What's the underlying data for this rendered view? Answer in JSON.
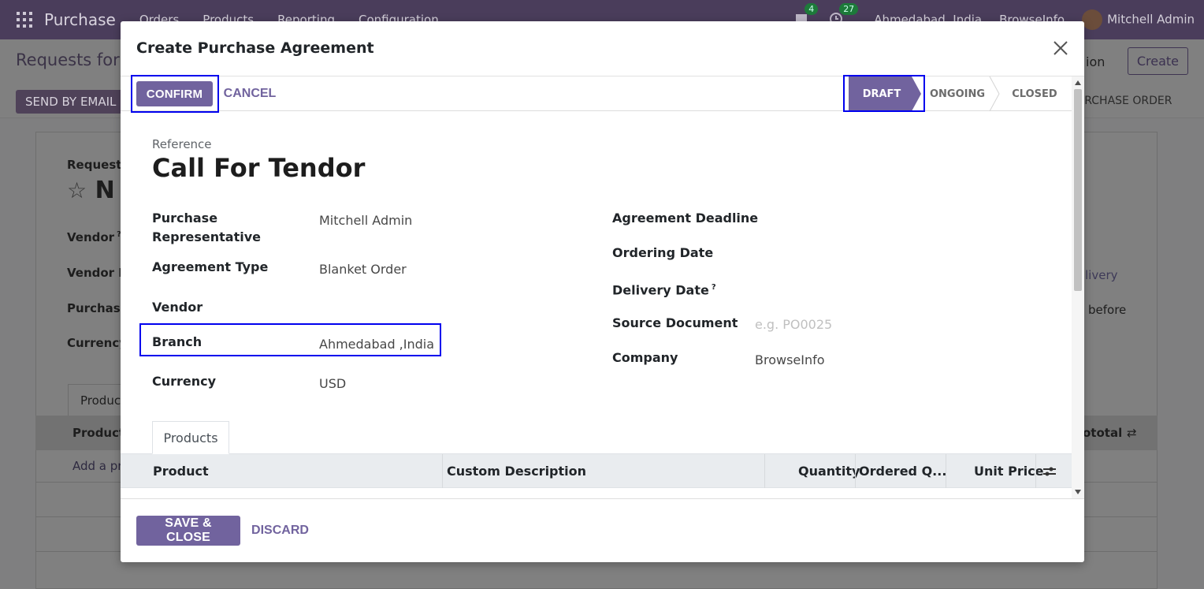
{
  "background": {
    "app_name": "Purchase",
    "menu": [
      "Orders",
      "Products",
      "Reporting",
      "Configuration"
    ],
    "messages_count": "4",
    "activities_count": "27",
    "branch": "Ahmedabad ,India",
    "company": "BrowseInfo",
    "user": "Mitchell Admin",
    "breadcrumb": "Requests for",
    "create_label": "Create",
    "action_label": "ion",
    "send_by_email": "SEND BY EMAIL",
    "purchase_order": "URCHASE ORDER",
    "request_label": "Request",
    "record_name_fragment": "N",
    "vendor_label": "Vendor",
    "vendor_ref_label": "Vendor R",
    "purchase_label": "Purchase",
    "currency_label": "Currency",
    "product_tab": "Produc",
    "product_col": "Product",
    "subtotal_col": "ototal",
    "add_product": "Add a pr",
    "delivery_fragment": "livery",
    "before_fragment": "before"
  },
  "modal": {
    "title": "Create Purchase Agreement",
    "confirm_label": "CONFIRM",
    "cancel_label": "CANCEL",
    "stages": [
      "DRAFT",
      "ONGOING",
      "CLOSED"
    ],
    "reference_label": "Reference",
    "reference_value": "Call For Tendor",
    "left_fields": [
      {
        "label": "Purchase Representative",
        "value": "Mitchell Admin"
      },
      {
        "label": "Agreement Type",
        "value": "Blanket Order"
      },
      {
        "label": "Vendor",
        "value": ""
      },
      {
        "label": "Branch",
        "value": "Ahmedabad ,India"
      },
      {
        "label": "Currency",
        "value": "USD"
      }
    ],
    "right_fields": [
      {
        "label": "Agreement Deadline",
        "value": ""
      },
      {
        "label": "Ordering Date",
        "value": ""
      },
      {
        "label": "Delivery Date",
        "value": "",
        "help": "?"
      },
      {
        "label": "Source Document",
        "placeholder": "e.g. PO0025"
      },
      {
        "label": "Company",
        "value": "BrowseInfo"
      }
    ],
    "tab_label": "Products",
    "columns": [
      "Product",
      "Custom Description",
      "Quantity",
      "Ordered Q...",
      "Unit Price"
    ],
    "save_close_label": "SAVE & CLOSE",
    "discard_label": "DISCARD"
  },
  "colors": {
    "primary": "#71639e",
    "highlight": "#0000ee",
    "navbar": "#4a3d5b"
  }
}
